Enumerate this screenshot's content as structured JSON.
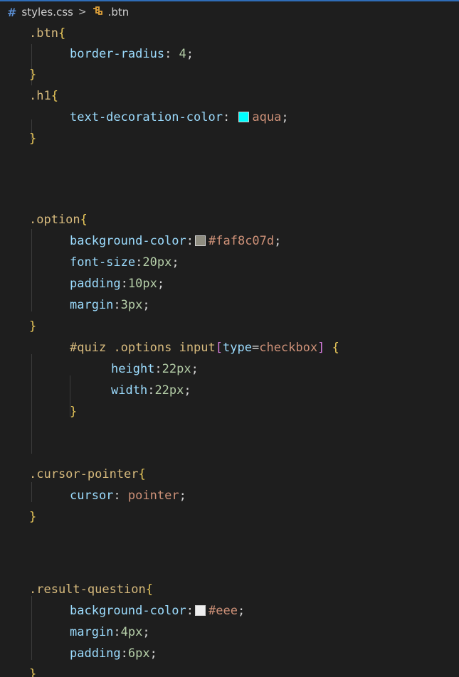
{
  "breadcrumb": {
    "file": "styles.css",
    "separator": ">",
    "symbol": ".btn",
    "file_icon": "hash-icon",
    "symbol_icon": "class-symbol-icon"
  },
  "colors": {
    "aqua": "#00ffff",
    "faf8c07d": "#8f8d80",
    "eee": "#eeeeee"
  },
  "code": {
    "btn_selector": ".btn",
    "btn_prop": "border-radius",
    "btn_val": "4",
    "h1_selector": ".h1",
    "h1_prop": "text-decoration-color",
    "h1_val": "aqua",
    "option_selector": ".option",
    "option_bg_prop": "background-color",
    "option_bg_val": "#faf8c07d",
    "option_fs_prop": "font-size",
    "option_fs_val": "20px",
    "option_pad_prop": "padding",
    "option_pad_val": "10px",
    "option_margin_prop": "margin",
    "option_margin_val": "3px",
    "quiz_selector_a": "#quiz",
    "quiz_selector_b": ".options",
    "quiz_selector_c": "input",
    "quiz_attr": "type",
    "quiz_attr_val": "checkbox",
    "quiz_height_prop": "height",
    "quiz_height_val": "22px",
    "quiz_width_prop": "width",
    "quiz_width_val": "22px",
    "cursor_selector": ".cursor-pointer",
    "cursor_prop": "cursor",
    "cursor_val": "pointer",
    "result_selector": ".result-question",
    "result_bg_prop": "background-color",
    "result_bg_val": "#eee",
    "result_margin_prop": "margin",
    "result_margin_val": "4px",
    "result_pad_prop": "padding",
    "result_pad_val": "6px"
  }
}
